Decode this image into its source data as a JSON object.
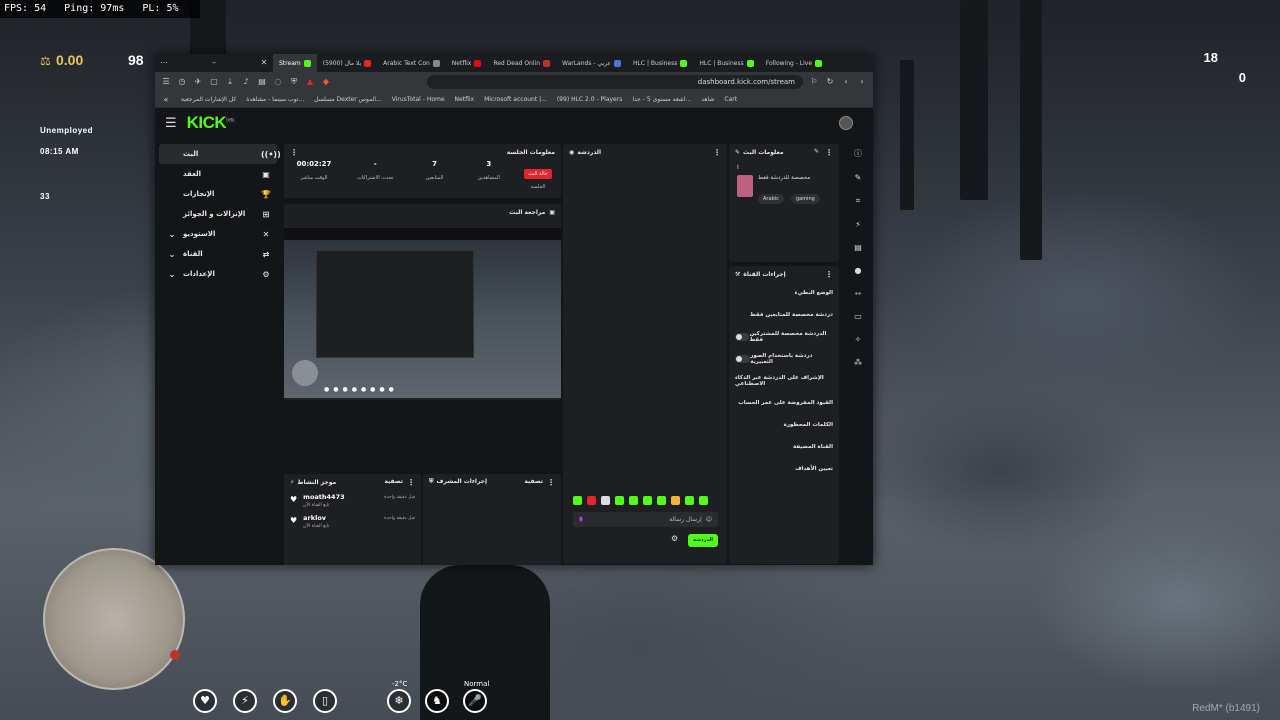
{
  "hud": {
    "fps": "FPS: 54",
    "ping": "Ping: 97ms",
    "pl": "PL: 5%",
    "money": "0.00",
    "money2": "98",
    "job": "Unemployed",
    "time": "08:15 AM",
    "players": "33",
    "ammo_count": "18",
    "ammo_zero": "0",
    "temperature": "-2°C",
    "voice_mode": "Normal",
    "watermark": "RedM* (b1491)"
  },
  "browser": {
    "tabs": [
      {
        "label": "Stream",
        "color": "#53fc18",
        "active": true
      },
      {
        "label": "بلا مال (5900)",
        "color": "#e5252a",
        "active": false
      },
      {
        "label": "Arabic Text Con",
        "color": "#888888",
        "active": false
      },
      {
        "label": "Netflix",
        "color": "#e50914",
        "active": false
      },
      {
        "label": "Red Dead Onlin",
        "color": "#c0312b",
        "active": false
      },
      {
        "label": "WarLands - عربي",
        "color": "#4a76d8",
        "active": false
      },
      {
        "label": "HLC | Business",
        "color": "#53fc18",
        "active": false
      },
      {
        "label": "HLC | Business",
        "color": "#53fc18",
        "active": false
      },
      {
        "label": "Following - Live",
        "color": "#53fc18",
        "active": false
      }
    ],
    "url": "dashboard.kick.com/stream",
    "bookmarks": [
      "كل الإشارات المرجعية",
      "توب سينما - مشاهدة...",
      "مسلسل Dexter الموس...",
      "VirusTotal - Home",
      "Netflix",
      "Microsoft account |...",
      "(99) HLC 2.0 - Players",
      "اشعه مستوى 5 - جدا...",
      "شاهد",
      "Cart"
    ]
  },
  "kick": {
    "logo": "KICK",
    "logo_sup": "beta",
    "sidebar": [
      {
        "label": "البث",
        "icon": "((•))",
        "active": true
      },
      {
        "label": "العقد",
        "icon": "▣",
        "active": false
      },
      {
        "label": "الإنجازات",
        "icon": "🏆",
        "active": false
      },
      {
        "label": "الإنزالات و الجوائز",
        "icon": "⊞",
        "active": false
      },
      {
        "label": "الاستوديو",
        "icon": "✕",
        "active": false,
        "expand": "⌄"
      },
      {
        "label": "القناة",
        "icon": "⇄",
        "active": false,
        "expand": "⌄"
      },
      {
        "label": "الإعدادات",
        "icon": "⚙",
        "active": false,
        "expand": "⌄"
      }
    ],
    "session": {
      "title": "معلومات الجلسة",
      "live_badge": "حالة البث",
      "session_label": "الجلسة",
      "stats": [
        {
          "value": "00:02:27",
          "label": "الوقت مباشر"
        },
        {
          "value": "-",
          "label": "تحدث الاشتراكات"
        },
        {
          "value": "7",
          "label": "المتابعين"
        },
        {
          "value": "3",
          "label": "المشاهدين"
        }
      ]
    },
    "preview_title": "مراجعة البث",
    "activity": {
      "title": "موجز النشاط",
      "filter": "تصفية",
      "items": [
        {
          "name": "moath4473",
          "sub": "تابع القناة الآن",
          "time": "قبل دقيقة واحدة"
        },
        {
          "name": "arklov",
          "sub": "تابع القناة الآن",
          "time": "قبل دقيقة واحدة"
        }
      ]
    },
    "moderation": {
      "title": "إجراءات المشرف",
      "filter": "تصفية"
    },
    "chat": {
      "title": "الدردشة",
      "placeholder": "إرسال رسالة",
      "send": "الدردشة"
    },
    "stream_info": {
      "title": "معلومات البث",
      "stream_title": "مخصصة للدردشة فقط",
      "tags": [
        "Arabic",
        "gaming"
      ],
      "cursor": "I"
    },
    "channel_actions": {
      "title": "إجراءات القناة",
      "items": [
        {
          "label": "الوضع البطيء",
          "toggle": false
        },
        {
          "label": "دردشة مخصصة للمتابعين فقط",
          "toggle": false
        },
        {
          "label": "الدردشة مخصصة للمشتركين فقط",
          "toggle": true
        },
        {
          "label": "دردشة باستخدام الصور التعبيرية",
          "toggle": true
        },
        {
          "label": "الإشراف على الدردشة عبر الذكاء الاصطناعي",
          "toggle": false
        },
        {
          "label": "القيود المفروضة على عمر الحساب",
          "toggle": false
        },
        {
          "label": "الكلمات المحظورة",
          "toggle": false
        },
        {
          "label": "القناة المضيفة",
          "toggle": false
        },
        {
          "label": "تعيين الأهداف",
          "toggle": false
        }
      ]
    }
  }
}
